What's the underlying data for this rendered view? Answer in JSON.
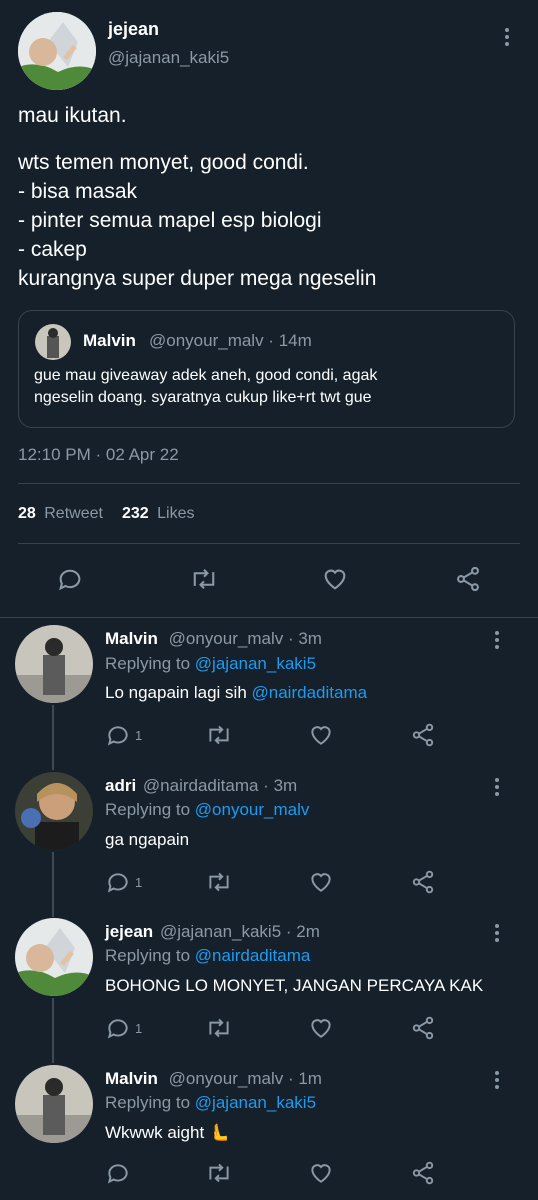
{
  "main_tweet": {
    "name": "jejean",
    "handle": "@jajanan_kaki5",
    "text_line1": "mau ikutan.",
    "text_lines": [
      "wts temen monyet, good condi.",
      "- bisa masak",
      "- pinter semua mapel esp biologi",
      "- cakep",
      "kurangnya super duper mega ngeselin"
    ],
    "quote": {
      "name": "Malvin",
      "handle_time": "@onyour_malv · 14m",
      "line1": "gue mau giveaway adek aneh, good condi, agak",
      "line2": "ngeselin doang. syaratnya cukup like+rt twt gue"
    },
    "timestamp": "12:10 PM · 02 Apr 22",
    "retweet_count": "28",
    "retweet_label": "Retweet",
    "like_count": "232",
    "like_label": "Likes"
  },
  "replies": [
    {
      "name": "Malvin",
      "handle_time": "@onyour_malv · 3m",
      "replying_label": "Replying to",
      "replying_to": "@jajanan_kaki5",
      "text": "Lo ngapain lagi sih ",
      "mention": "@nairdaditama",
      "reply_count": "1"
    },
    {
      "name": "adri",
      "handle_time": "@nairdaditama · 3m",
      "replying_label": "Replying to",
      "replying_to": "@onyour_malv",
      "text": "ga ngapain",
      "mention": "",
      "reply_count": "1"
    },
    {
      "name": "jejean",
      "handle_time": "@jajanan_kaki5 · 2m",
      "replying_label": "Replying to",
      "replying_to": "@nairdaditama",
      "text": "BOHONG LO MONYET, JANGAN PERCAYA KAK",
      "mention": "",
      "reply_count": "1"
    },
    {
      "name": "Malvin",
      "handle_time": "@onyour_malv · 1m",
      "replying_label": "Replying to",
      "replying_to": "@jajanan_kaki5",
      "text": "Wkwwk aight 🫷",
      "mention": "",
      "reply_count": ""
    }
  ],
  "colors": {
    "background": "#15202b",
    "link": "#1d9bf0",
    "muted": "#8b98a5",
    "divider": "#38444d"
  }
}
